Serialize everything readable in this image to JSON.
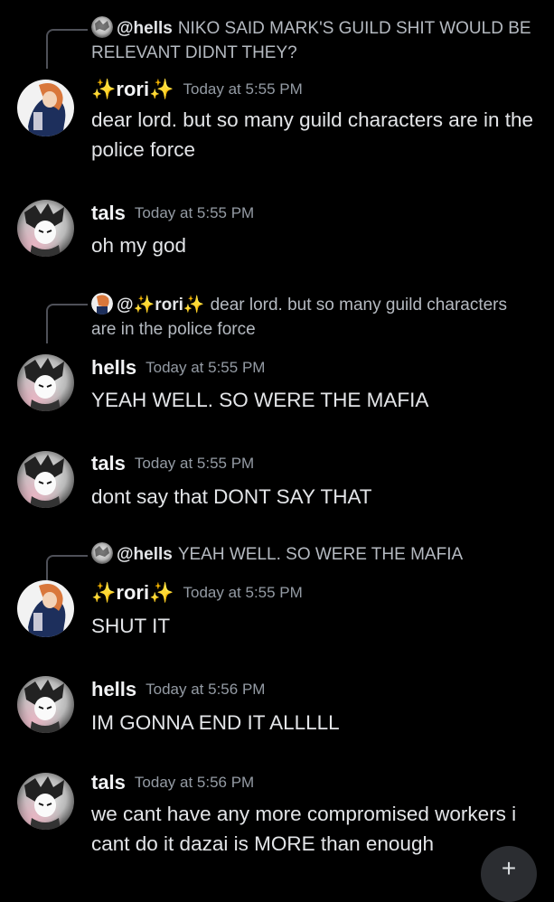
{
  "messages": [
    {
      "reply": {
        "user": "@hells",
        "text": "NIKO SAID MARK'S GUILD SHIT WOULD BE RELEVANT DIDNT THEY?"
      },
      "user": "rori",
      "time": "Today at 5:55 PM",
      "text": "dear lord. but so many guild characters are in the police force"
    },
    {
      "user": "tals",
      "time": "Today at 5:55 PM",
      "text": "oh my god"
    },
    {
      "reply": {
        "user": "@rori",
        "text": "dear lord. but so many guild characters are in the police force"
      },
      "user": "hells",
      "time": "Today at 5:55 PM",
      "text": "YEAH WELL. SO WERE THE MAFIA"
    },
    {
      "user": "tals",
      "time": "Today at 5:55 PM",
      "text": "dont say that DONT SAY THAT"
    },
    {
      "reply": {
        "user": "@hells",
        "text": "YEAH WELL. SO WERE THE MAFIA"
      },
      "user": "rori",
      "time": "Today at 5:55 PM",
      "text": "SHUT IT"
    },
    {
      "user": "hells",
      "time": "Today at 5:56 PM",
      "text": "IM GONNA END IT ALLLLL"
    },
    {
      "user": "tals",
      "time": "Today at 5:56 PM",
      "text": "we cant have any more compromised workers i cant do it dazai is MORE than enough"
    }
  ],
  "decor": {
    "sparkle": "✨",
    "add_button": "+"
  },
  "colors": {
    "background": "#000000",
    "username": "#f2f3f5",
    "timestamp": "#949ba4",
    "body_text": "#e3e5e8",
    "reply_text": "#b5bac1",
    "sparkle": "#f8d34a"
  }
}
